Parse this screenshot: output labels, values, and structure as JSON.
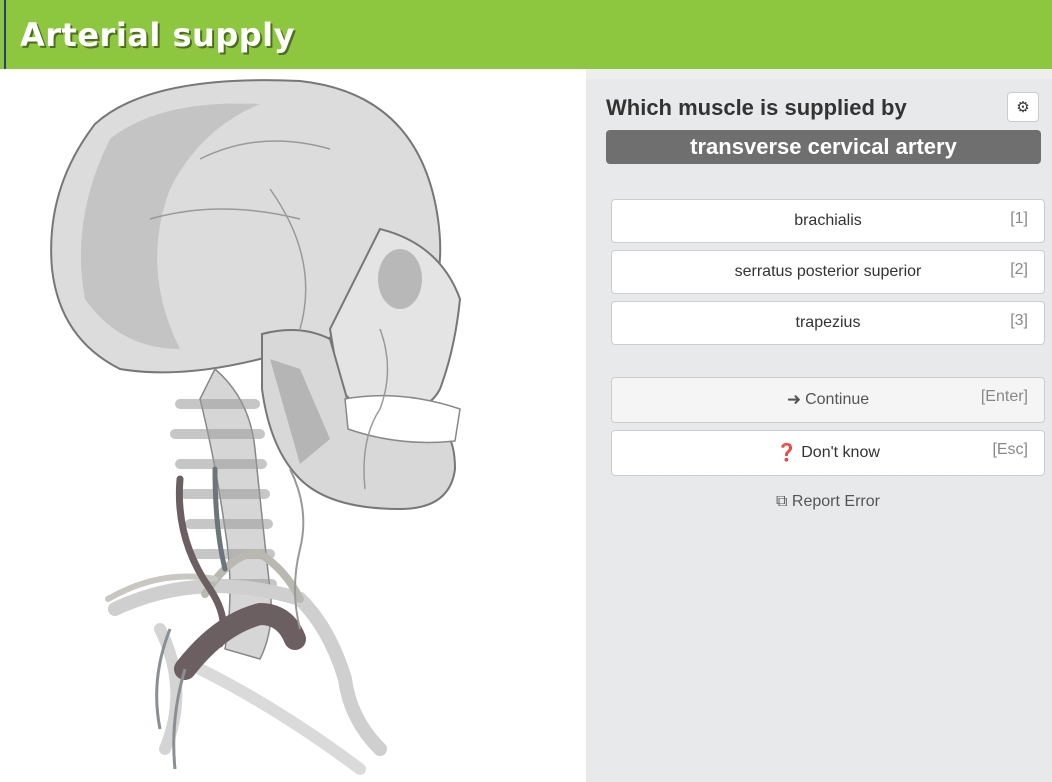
{
  "header": {
    "title": "Arterial supply"
  },
  "quiz": {
    "question": "Which muscle is supplied by",
    "term": "transverse cervical artery",
    "settings_icon": "gear-icon",
    "answers": [
      {
        "label": "brachialis",
        "key": "[1]"
      },
      {
        "label": "serratus posterior superior",
        "key": "[2]"
      },
      {
        "label": "trapezius",
        "key": "[3]"
      }
    ],
    "continue": {
      "label": "Continue",
      "key": "[Enter]",
      "icon": "arrow-right-icon"
    },
    "dont_know": {
      "label": "Don't know",
      "key": "[Esc]",
      "icon": "question-circle-icon"
    },
    "report": {
      "label": "Report Error",
      "icon": "external-link-icon"
    }
  },
  "colors": {
    "header": "#8dc63f",
    "term_bg": "#6f6f6f",
    "panel_bg": "#e8e9eb",
    "artery_highlight": "#6b5f62"
  }
}
